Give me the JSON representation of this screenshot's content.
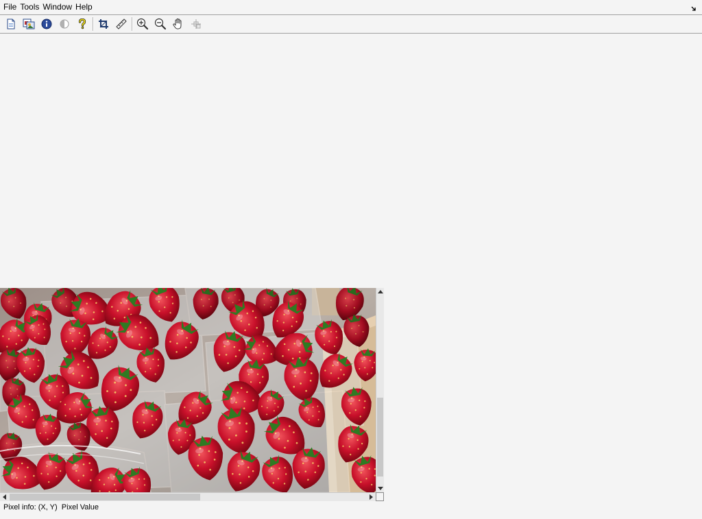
{
  "menu": {
    "items": [
      "File",
      "Tools",
      "Window",
      "Help"
    ]
  },
  "toolbar": {
    "tools": [
      "new-figure-icon",
      "export-image-icon",
      "image-info-icon",
      "contrast-icon",
      "help-icon",
      "crop-icon",
      "measure-distance-icon",
      "zoom-in-icon",
      "zoom-out-icon",
      "pan-hand-icon",
      "pixel-region-icon"
    ]
  },
  "image": {
    "subject": "strawberries in plastic punnets"
  },
  "status": {
    "pixel_info_label": "Pixel info:",
    "pixel_info_value": "(X, Y)  Pixel Value"
  },
  "colors": {
    "background": "#f4f4f4",
    "separator": "#a0a0a0",
    "scroll_track": "#e8e8e8",
    "scroll_thumb": "#c8c8c8"
  }
}
